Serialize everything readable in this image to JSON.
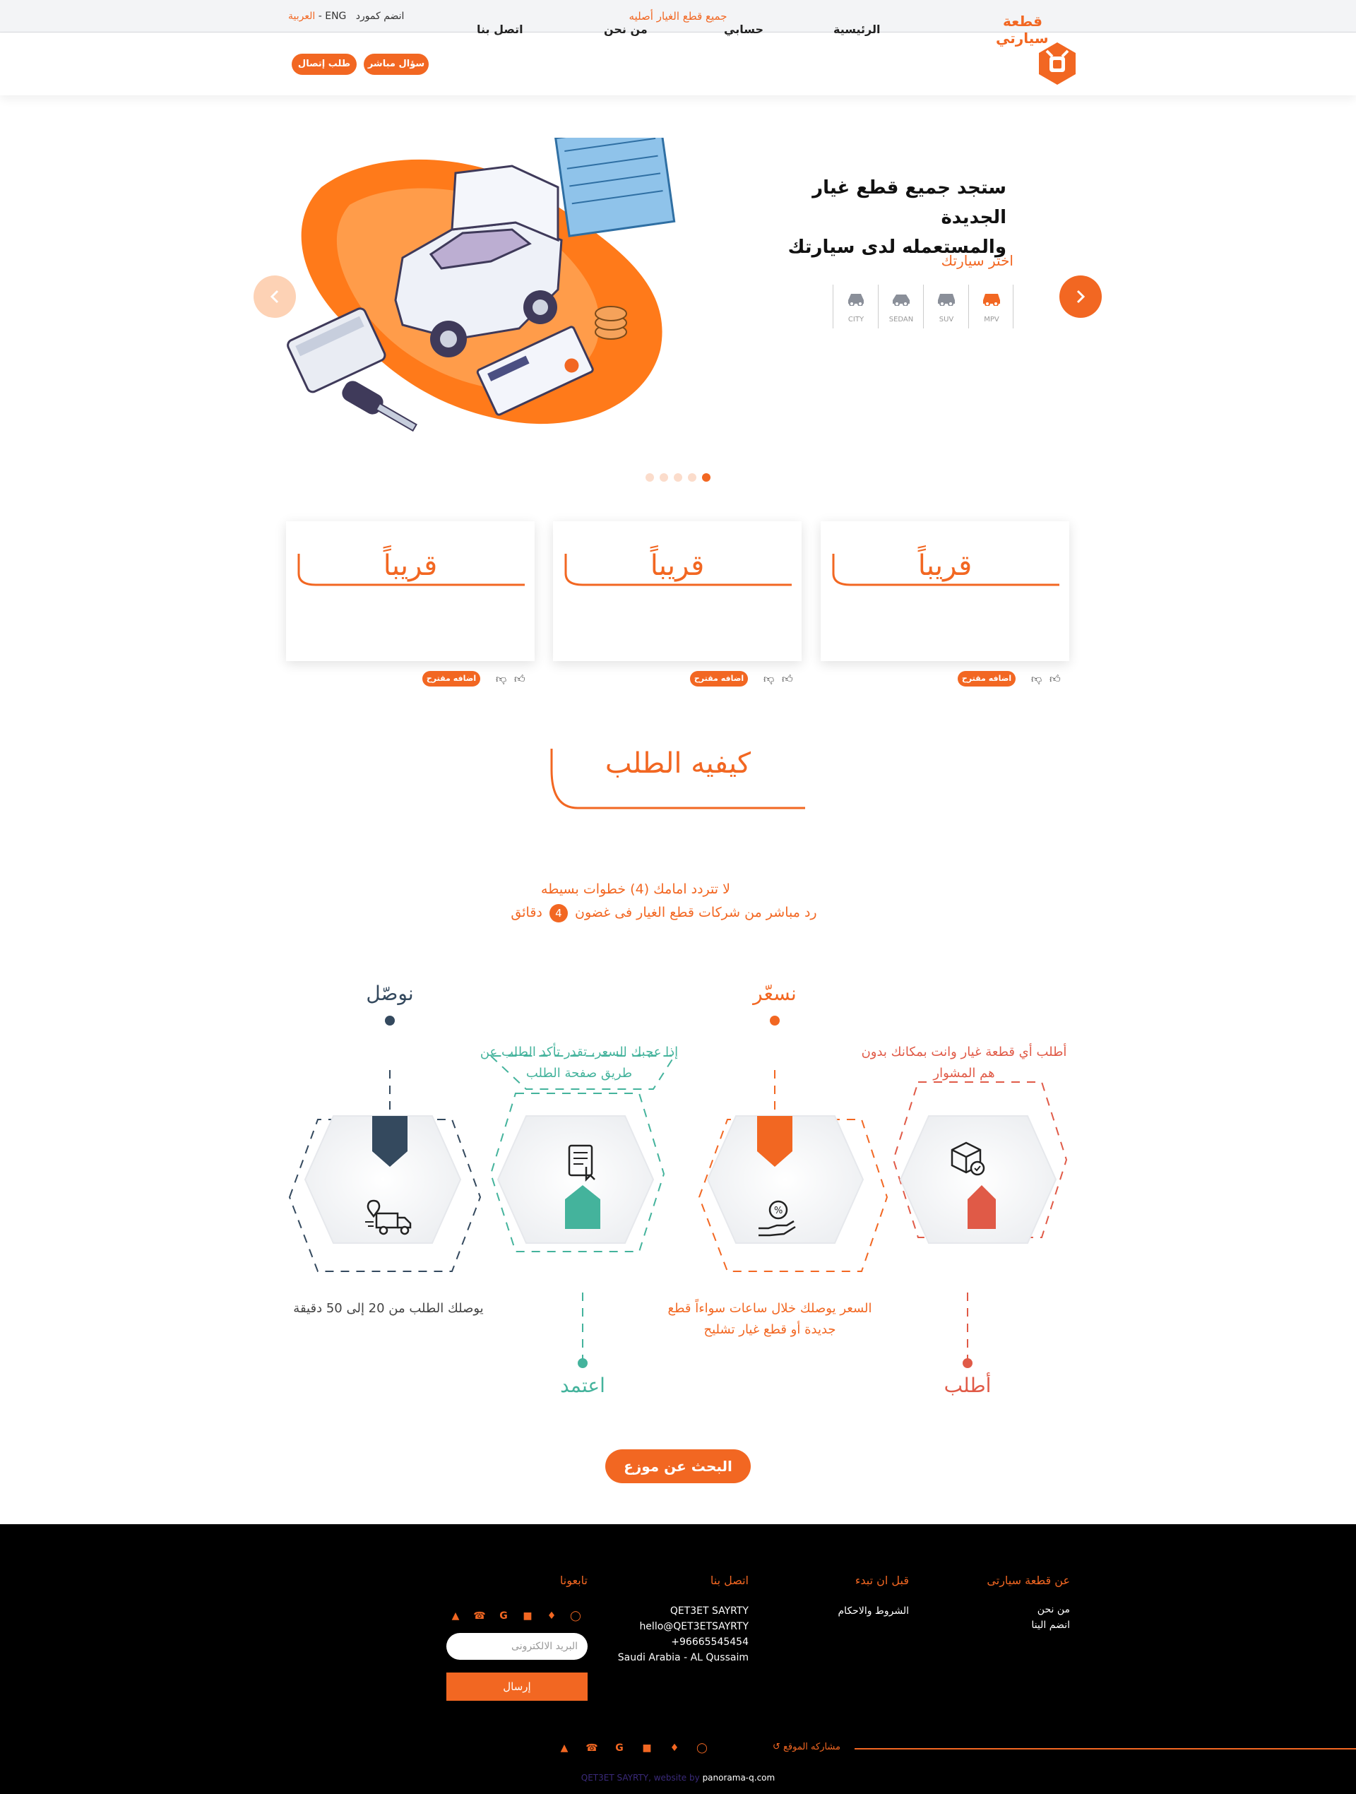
{
  "topbar": {
    "center_text": "جميع قطع الغيار أصليه",
    "lang_ar": "العربية",
    "lang_sep": "-",
    "lang_en": "ENG",
    "join_supplier": "انضم كمورد"
  },
  "nav": {
    "logo_line1": "قطعة",
    "logo_line2": "سيارتي",
    "items": [
      "الرئيسية",
      "حسابي",
      "من نحن",
      "اتصل بنا"
    ],
    "direct_question": "سؤال مباشر",
    "call_request": "طلب إتصال"
  },
  "hero": {
    "title_line1": "ستجد جميع قطع غيار الجديدة",
    "title_line2": "والمستعمله لدى سيارتك",
    "choose_car": "اختر سيارتك",
    "car_types": [
      "MPV",
      "SUV",
      "SEDAN",
      "CITY"
    ],
    "slides_count": 5,
    "active_slide": 5
  },
  "cards": [
    {
      "title": "قريباً",
      "suggest": "اضافه مقترح"
    },
    {
      "title": "قريباً",
      "suggest": "اضافه مقترح"
    },
    {
      "title": "قريباً",
      "suggest": "اضافه مقترح"
    }
  ],
  "how": {
    "title": "كيفيه الطلب",
    "sub1": "لا تتردد امامك (4) خطوات بسيطه",
    "sub2_a": "رد مباشر من شركات قطع الغيار فى غضون",
    "sub2_num": "4",
    "sub2_b": "دقائق",
    "steps": [
      {
        "title": "أطلب",
        "desc": "أطلب أي قطعة غيار وانت بمكانك بدون هم المشوار",
        "color": "#e05a47"
      },
      {
        "title": "نسعّر",
        "desc": "السعر يوصلك خلال ساعات سواءاً قطع جديدة أو قطع غيار تشليح",
        "color": "#f26722"
      },
      {
        "title": "اعتمد",
        "desc": "إذا عجبك السعر، تقدر تأكد الطلب عن طريق صفحة الطلب",
        "color": "#44b39c"
      },
      {
        "title": "نوصّل",
        "desc": "يوصلك الطلب من 20 إلى 50 دقيقة",
        "color": "#34495e"
      }
    ],
    "search_button": "البحث عن موزع"
  },
  "footer": {
    "about_head": "عن قطعة سيارتى",
    "about_links": [
      "من نحن",
      "انضم الينا"
    ],
    "before_head": "قبل ان تبدء",
    "before_links": [
      "الشروط والاحكام"
    ],
    "contact_head": "اتصل بنا",
    "contact_lines": [
      "QET3ET SAYRTY",
      "hello@QET3ETSAYRTY",
      "+96665545454",
      "Saudi Arabia - AL Qussaim"
    ],
    "follow_head": "تابعونا",
    "email_placeholder": "البريد الالكترونى",
    "send_button": "إرسال",
    "share_label": "مشاركه الموقع",
    "credit_a": "QET3ET SAYRTY, website by",
    "credit_b": "panorama-q.com"
  },
  "colors": {
    "accent": "#f26722",
    "footer_bg": "#000000"
  }
}
